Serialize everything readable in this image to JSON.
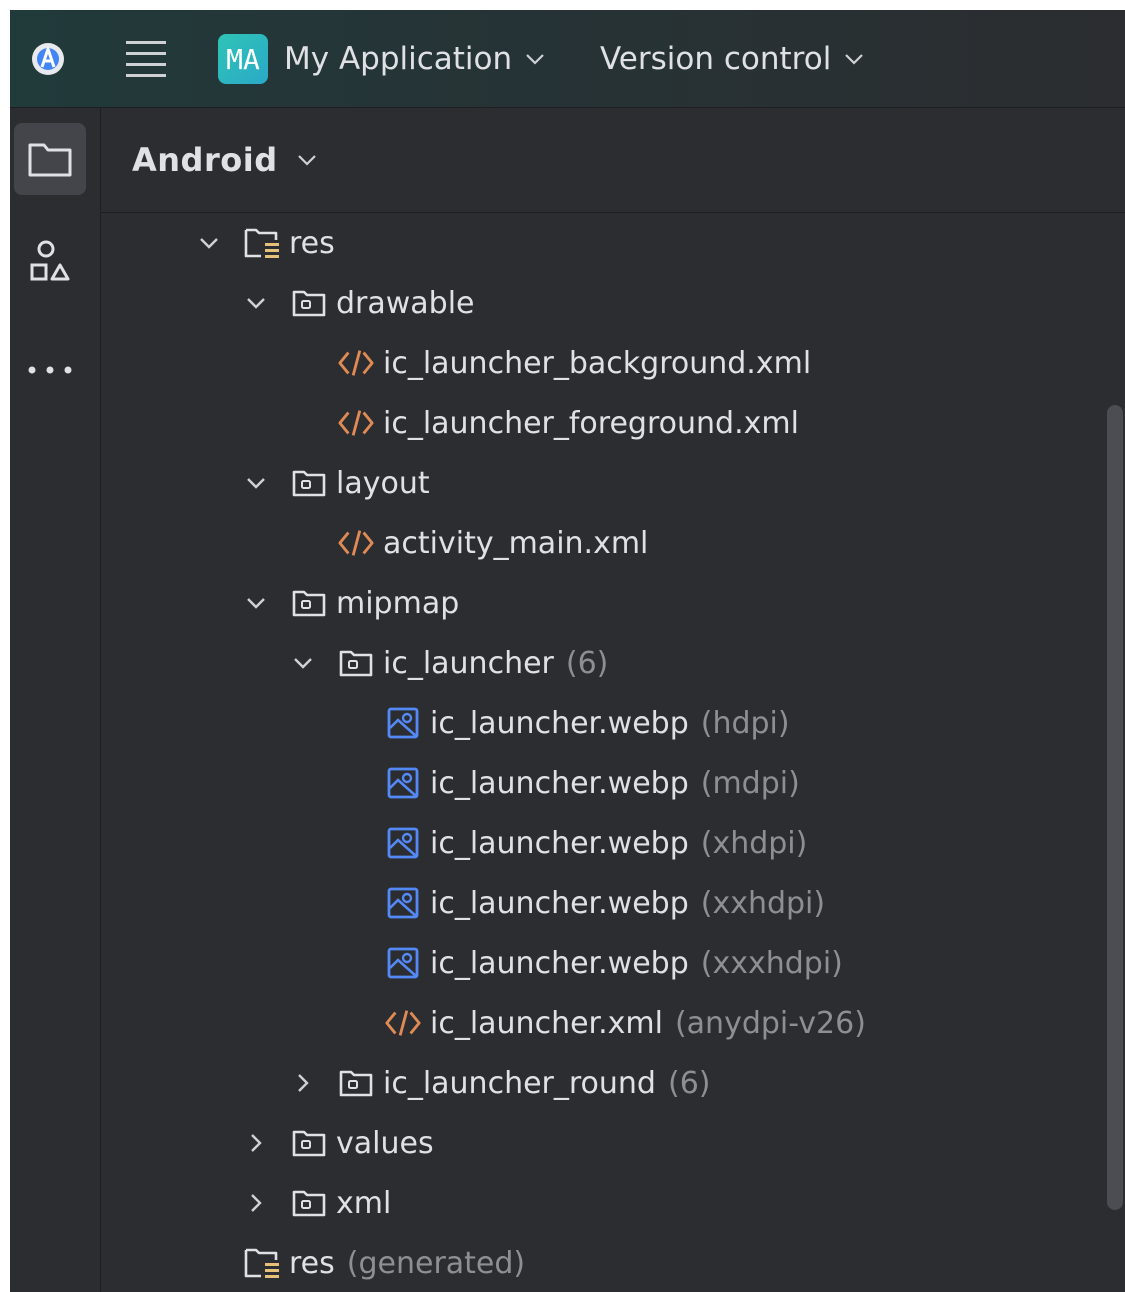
{
  "titlebar": {
    "project_badge": "MA",
    "project_name": "My Application",
    "vcs_label": "Version control"
  },
  "toolstrip": {
    "items": [
      "project-folder-icon",
      "structure-shapes-icon",
      "more-ellipsis-icon"
    ]
  },
  "panel": {
    "view_mode": "Android"
  },
  "tree": [
    {
      "depth": 0,
      "expand": "open",
      "icon": "res-folder-icon",
      "name": "res",
      "hint": ""
    },
    {
      "depth": 1,
      "expand": "open",
      "icon": "folder-icon",
      "name": "drawable",
      "hint": ""
    },
    {
      "depth": 2,
      "expand": "none",
      "icon": "xml-file-icon",
      "name": "ic_launcher_background.xml",
      "hint": ""
    },
    {
      "depth": 2,
      "expand": "none",
      "icon": "xml-file-icon",
      "name": "ic_launcher_foreground.xml",
      "hint": ""
    },
    {
      "depth": 1,
      "expand": "open",
      "icon": "folder-icon",
      "name": "layout",
      "hint": ""
    },
    {
      "depth": 2,
      "expand": "none",
      "icon": "xml-file-icon",
      "name": "activity_main.xml",
      "hint": ""
    },
    {
      "depth": 1,
      "expand": "open",
      "icon": "folder-icon",
      "name": "mipmap",
      "hint": ""
    },
    {
      "depth": 2,
      "expand": "open",
      "icon": "folder-icon",
      "name": "ic_launcher",
      "hint": "(6)"
    },
    {
      "depth": 3,
      "expand": "none",
      "icon": "image-file-icon",
      "name": "ic_launcher.webp",
      "hint": "(hdpi)"
    },
    {
      "depth": 3,
      "expand": "none",
      "icon": "image-file-icon",
      "name": "ic_launcher.webp",
      "hint": "(mdpi)"
    },
    {
      "depth": 3,
      "expand": "none",
      "icon": "image-file-icon",
      "name": "ic_launcher.webp",
      "hint": "(xhdpi)"
    },
    {
      "depth": 3,
      "expand": "none",
      "icon": "image-file-icon",
      "name": "ic_launcher.webp",
      "hint": "(xxhdpi)"
    },
    {
      "depth": 3,
      "expand": "none",
      "icon": "image-file-icon",
      "name": "ic_launcher.webp",
      "hint": "(xxxhdpi)"
    },
    {
      "depth": 3,
      "expand": "none",
      "icon": "xml-file-icon",
      "name": "ic_launcher.xml",
      "hint": "(anydpi-v26)"
    },
    {
      "depth": 2,
      "expand": "closed",
      "icon": "folder-icon",
      "name": "ic_launcher_round",
      "hint": "(6)"
    },
    {
      "depth": 1,
      "expand": "closed",
      "icon": "folder-icon",
      "name": "values",
      "hint": ""
    },
    {
      "depth": 1,
      "expand": "closed",
      "icon": "folder-icon",
      "name": "xml",
      "hint": ""
    },
    {
      "depth": 0,
      "expand": "none",
      "icon": "res-folder-icon",
      "name": "res",
      "hint": "(generated)"
    }
  ],
  "colors": {
    "background": "#2b2d30",
    "text": "#dfe1e5",
    "hint": "#8c8f94",
    "xml_icon": "#e08a54",
    "image_icon": "#548af7",
    "res_icon_accent": "#e5c07b",
    "badge": "#2fc4b6"
  }
}
